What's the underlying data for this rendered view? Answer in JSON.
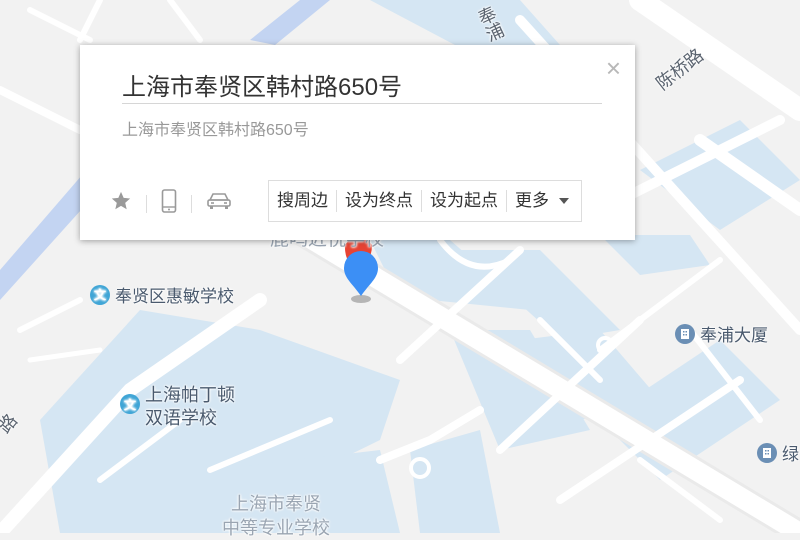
{
  "info_window": {
    "title": "上海市奉贤区韩村路650号",
    "address": "上海市奉贤区韩村路650号",
    "close_label": "×",
    "actions": {
      "nearby": "搜周边",
      "set_destination": "设为终点",
      "set_origin": "设为起点",
      "more": "更多"
    },
    "icons": [
      "star-icon",
      "phone-icon",
      "car-icon"
    ]
  },
  "map_labels": {
    "poi_huimin": "奉贤区惠敏学校",
    "poi_padington_line1": "上海帕丁顿",
    "poi_padington_line2": "双语学校",
    "poi_fengpu_tower": "奉浦大厦",
    "poi_right_edge": "绿",
    "poi_vocational_line1": "上海市奉贤",
    "poi_vocational_line2": "中等专业学校",
    "poi_behind_marker": "鹿鸣近悦学校",
    "poi_icon_edu": "文",
    "road_chenqiao": "陈桥路",
    "road_fengpu": "奉浦",
    "road_left": "路"
  },
  "colors": {
    "water": "#d5e6f3",
    "road": "#ffffff",
    "background": "#f2f2f2",
    "river": "#c3d4f2",
    "marker_blue": "#3c8ff5",
    "marker_red": "#e74333"
  }
}
